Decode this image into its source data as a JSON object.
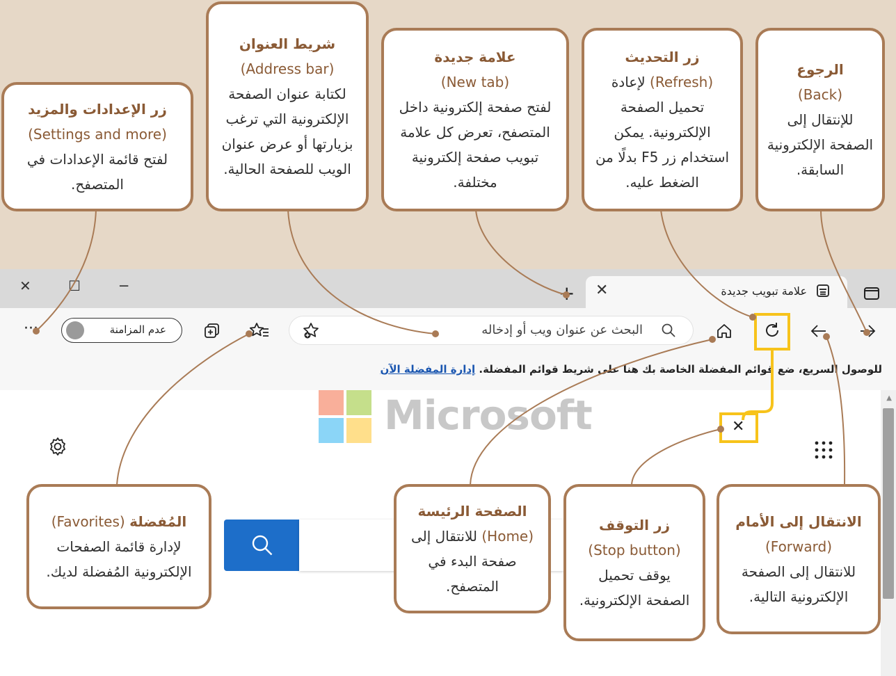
{
  "callouts": {
    "back": {
      "title": "الرجوع",
      "en": "(Back)",
      "desc": "للإنتقال إلى الصفحة الإلكترونية السابقة."
    },
    "refresh": {
      "title": "زر التحديث",
      "en": "(Refresh)",
      "desc": "لإعادة تحميل الصفحة الإلكترونية. يمكن استخدام زر F5 بدلًا من الضغط عليه."
    },
    "new_tab": {
      "title": "علامة جديدة",
      "en": "(New tab)",
      "desc": "لفتح صفحة إلكترونية داخل المتصفح، تعرض كل علامة تبويب صفحة إلكترونية مختلفة."
    },
    "address_bar": {
      "title": "شريط العنوان",
      "en": "(Address bar)",
      "desc": "لكتابة عنوان الصفحة الإلكترونية التي ترغب بزيارتها أو عرض عنوان الويب للصفحة الحالية."
    },
    "settings": {
      "title": "زر الإعدادات والمزيد",
      "en": "(Settings and more)",
      "desc": "لفتح قائمة الإعدادات في المتصفح."
    },
    "favorites": {
      "title": "المُفضلة",
      "en": "(Favorites)",
      "desc": "لإدارة قائمة الصفحات الإلكترونية المُفضلة لديك."
    },
    "home": {
      "title": "الصفحة الرئيسة",
      "en": "(Home)",
      "desc": "للانتقال إلى صفحة البدء في المتصفح."
    },
    "stop": {
      "title": "زر التوقف",
      "en": "(Stop button)",
      "desc": "يوقف تحميل الصفحة الإلكترونية."
    },
    "forward": {
      "title": "الانتقال إلى الأمام",
      "en": "(Forward)",
      "desc": "للانتقال إلى الصفحة الإلكترونية التالية."
    }
  },
  "browser": {
    "tab_title": "علامة تبويب جديدة",
    "address_placeholder": "البحث عن عنوان ويب أو إدخاله",
    "sync_label": "عدم المزامنة",
    "favorites_bar_text": "للوصول السريع، ضع قوائم المفضلة الخاصة بك هنا على شريط قوائم المفضلة.",
    "favorites_bar_link": "إدارة المفضلة الآن",
    "brand": "Microsoft"
  },
  "colors": {
    "callout_border": "#a97b56",
    "highlight": "#f7c31b",
    "background": "#e6d8c7",
    "search_button": "#1d6ec9"
  }
}
